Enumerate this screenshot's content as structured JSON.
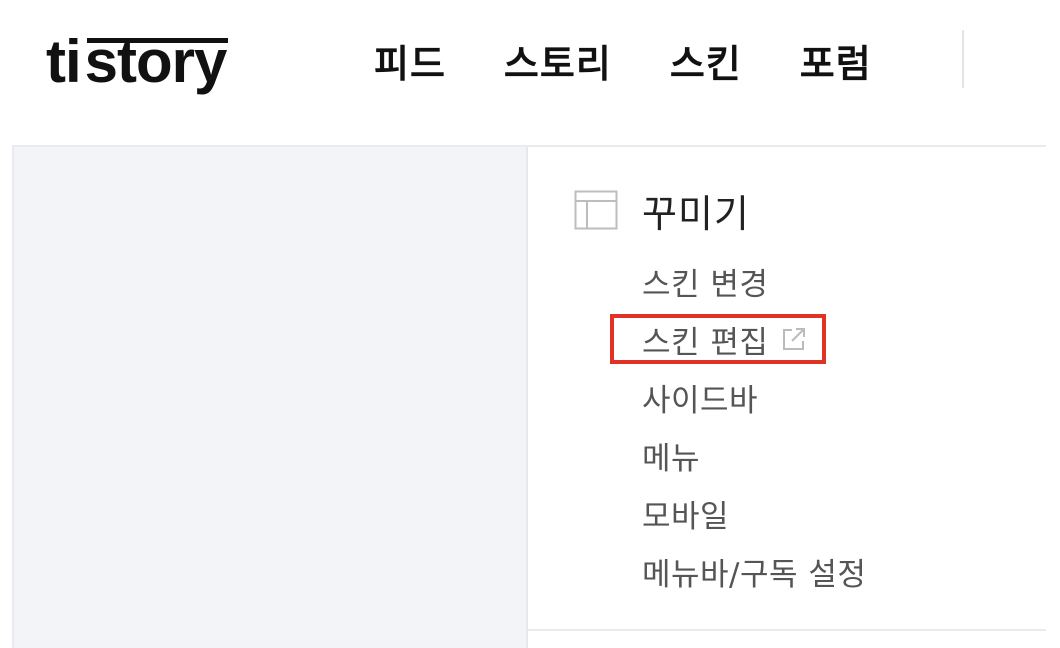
{
  "header": {
    "logo_part1": "ti",
    "logo_part2": "story",
    "nav": [
      {
        "label": "피드"
      },
      {
        "label": "스토리"
      },
      {
        "label": "스킨"
      },
      {
        "label": "포럼"
      }
    ]
  },
  "sidebar": {
    "section_icon": "layout-icon",
    "section_title": "꾸미기",
    "items": [
      {
        "label": "스킨 변경"
      },
      {
        "label": "스킨 편집",
        "icon": "external-link-icon"
      },
      {
        "label": "사이드바"
      },
      {
        "label": "메뉴"
      },
      {
        "label": "모바일"
      },
      {
        "label": "메뉴바/구독 설정"
      }
    ]
  },
  "colors": {
    "highlight": "#e03325",
    "left_pane_bg": "#f2f4f7"
  }
}
